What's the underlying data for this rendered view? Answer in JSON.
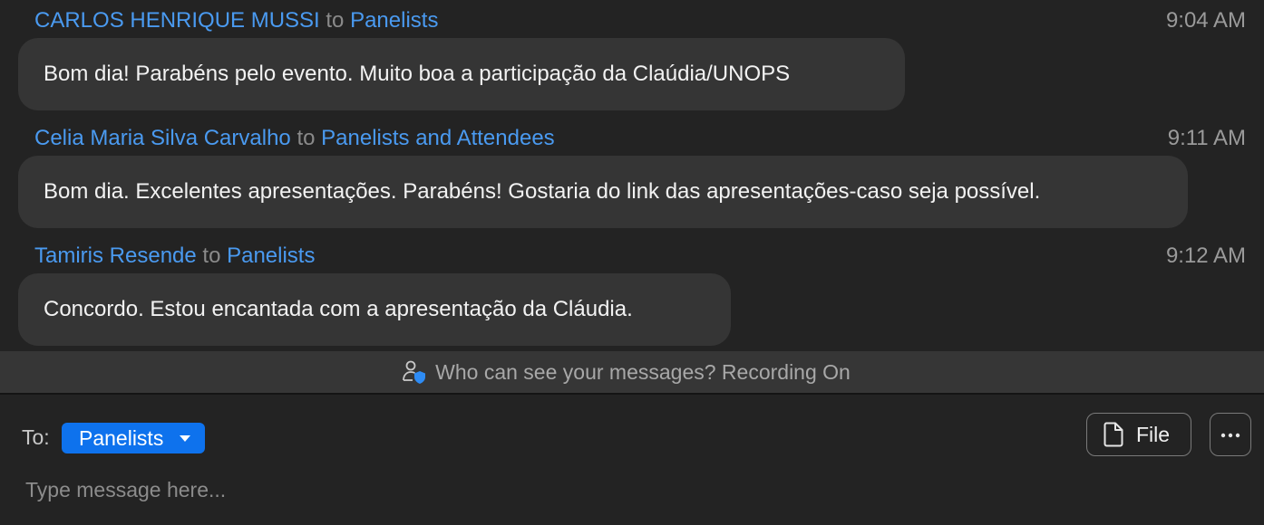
{
  "messages": [
    {
      "sender": "CARLOS HENRIQUE MUSSI",
      "to_word": "to",
      "recipient": "Panelists",
      "time": "9:04 AM",
      "text": "Bom dia! Parabéns pelo evento. Muito boa a participação da Claúdia/UNOPS"
    },
    {
      "sender": "Celia Maria Silva Carvalho",
      "to_word": "to",
      "recipient": "Panelists and Attendees",
      "time": "9:11 AM",
      "text": "Bom dia. Excelentes apresentações. Parabéns! Gostaria do link das apresentações-caso seja possível."
    },
    {
      "sender": "Tamiris Resende",
      "to_word": "to",
      "recipient": "Panelists",
      "time": "9:12 AM",
      "text": "Concordo. Estou encantada com a apresentação da Cláudia."
    }
  ],
  "notice": {
    "text": "Who can see your messages? Recording On",
    "icon": "person-shield-icon"
  },
  "compose": {
    "to_label": "To:",
    "recipient_selected": "Panelists",
    "file_label": "File",
    "file_icon": "file-icon",
    "more_icon": "more-icon",
    "placeholder": "Type message here..."
  },
  "colors": {
    "link_blue": "#4a9af0",
    "button_blue": "#0e72ed",
    "background": "#232323",
    "bubble": "#353535"
  }
}
